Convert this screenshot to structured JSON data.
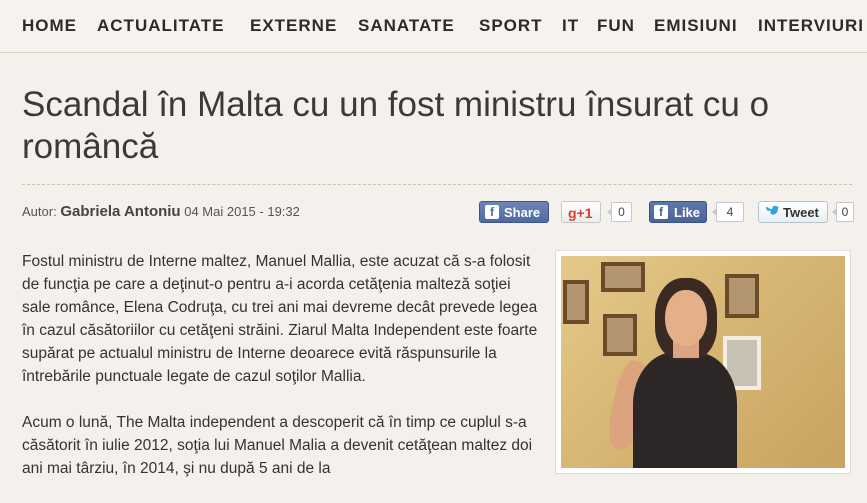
{
  "nav": {
    "items": [
      "HOME",
      "ACTUALITATE",
      "EXTERNE",
      "SANATATE",
      "SPORT",
      "IT",
      "FUN",
      "EMISIUNI",
      "INTERVIURI"
    ]
  },
  "article": {
    "title": "Scandal în Malta cu un fost ministru însurat cu o româncă",
    "author_prefix": "Autor:",
    "author": "Gabriela Antoniu",
    "date": "04 Mai 2015 - 19:32",
    "paragraphs": [
      "Fostul ministru de Interne maltez, Manuel Mallia, este acuzat că s-a folosit de funcţia pe care a deţinut-o pentru a-i acorda cetăţenia malteză soţiei sale românce, Elena Codruţa, cu trei ani mai devreme decât prevede legea în cazul căsătoriilor cu cetăţeni străini. Ziarul Malta Independent este foarte supărat pe actualul ministru de Interne deoarece evită răspunsurile la întrebările punctuale legate de cazul soţilor Mallia.",
      "Acum o lună, The Malta independent a descoperit că în timp ce cuplul s-a căsătorit în iulie 2012, soţia lui Manuel Malia a devenit cetăţean maltez doi ani mai târziu, în 2014, şi nu după 5 ani de la"
    ]
  },
  "social": {
    "facebook_share_label": "Share",
    "facebook_icon": "f",
    "gplus_label": "g+1",
    "gplus_count": "0",
    "like_label": "Like",
    "like_count": "4",
    "tweet_label": "Tweet",
    "tweet_count": "0"
  },
  "colors": {
    "background": "#f4f1ec",
    "facebook": "#4f6aa1",
    "gplus": "#d73d32",
    "twitter": "#2ca5e0"
  }
}
